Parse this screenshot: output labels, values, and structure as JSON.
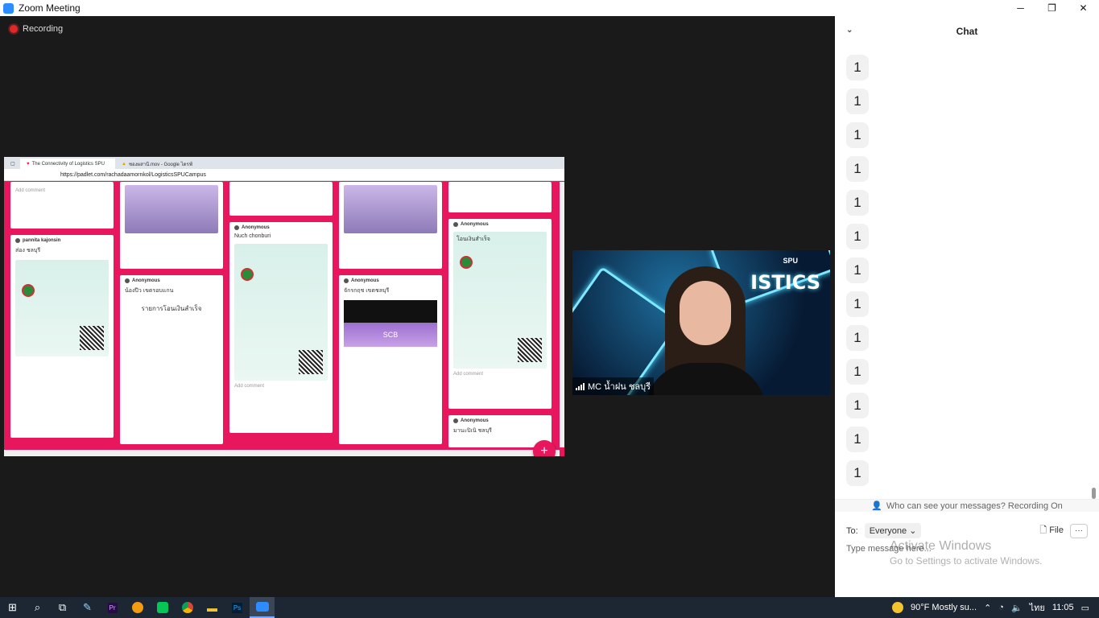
{
  "window": {
    "title": "Zoom Meeting",
    "controls": [
      "─",
      "❐",
      "✕"
    ]
  },
  "recording": {
    "label": "Recording"
  },
  "browser": {
    "tabs": [
      "The Connectivity of Logistics SPU",
      "ซองผสานี.mov - Google ไดรฟ์"
    ],
    "address": "https://padlet.com/rachadaamornkol/LogisticsSPUCampus",
    "cards": [
      {
        "author": "pannita kajonsin",
        "title": "ส่อง ชลบุรี",
        "meta": "Add comment"
      },
      {
        "author": "Anonymous",
        "title": "น้องปีว เขตรอบแกน",
        "meta": "รายการโอนเงินสำเร็จ"
      },
      {
        "author": "Anonymous",
        "title": "Nuch chonburi",
        "meta": "Add comment"
      },
      {
        "author": "Anonymous",
        "title": "จักรกฤช เขตชลบุรี",
        "meta": "SCB"
      },
      {
        "author": "Anonymous",
        "title": "โอนเงินสำเร็จ",
        "meta": "Add comment"
      },
      {
        "author": "Anonymous",
        "title": "มานะปิเนิ ชลบุรี",
        "meta": ""
      }
    ],
    "fab": "+"
  },
  "video": {
    "name": "MC น้ำฝน ชลบุรี",
    "banner_text": "ISTICS",
    "brand": "SPU"
  },
  "chat": {
    "title": "Chat",
    "messages": [
      "1",
      "1",
      "1",
      "1",
      "1",
      "1",
      "1",
      "1",
      "1",
      "1",
      "1",
      "1",
      "1"
    ],
    "privacy": "Who can see your messages? Recording On",
    "to_label": "To:",
    "recipient": "Everyone",
    "file_label": "File",
    "more_label": "···",
    "placeholder": "Type message here...",
    "watermark_title": "Activate Windows",
    "watermark_sub": "Go to Settings to activate Windows."
  },
  "taskbar": {
    "weather": "90°F  Mostly su...",
    "language": "ไทย",
    "time": "11:05"
  }
}
